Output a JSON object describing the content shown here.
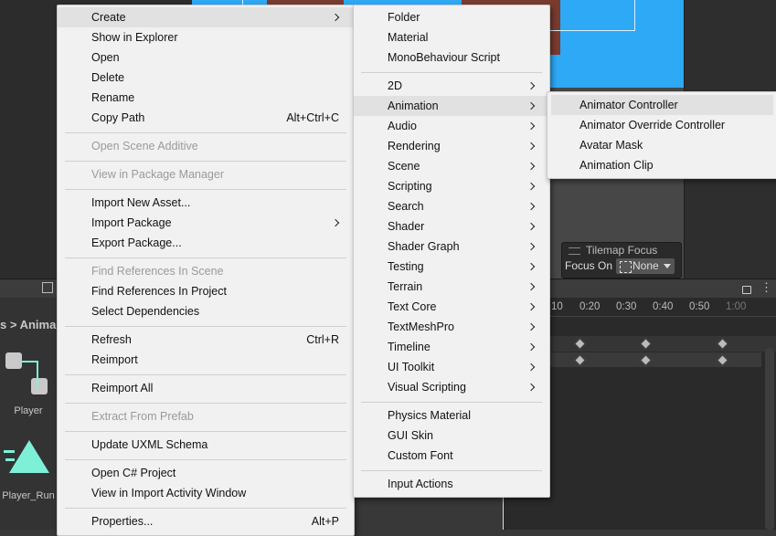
{
  "context_menu": {
    "items": [
      {
        "label": "Create",
        "submenu": true
      },
      {
        "label": "Show in Explorer"
      },
      {
        "label": "Open"
      },
      {
        "label": "Delete"
      },
      {
        "label": "Rename"
      },
      {
        "label": "Copy Path",
        "shortcut": "Alt+Ctrl+C"
      },
      {
        "label": "Open Scene Additive",
        "disabled": true
      },
      {
        "label": "View in Package Manager",
        "disabled": true
      },
      {
        "label": "Import New Asset..."
      },
      {
        "label": "Import Package",
        "submenu": true
      },
      {
        "label": "Export Package..."
      },
      {
        "label": "Find References In Scene",
        "disabled": true
      },
      {
        "label": "Find References In Project"
      },
      {
        "label": "Select Dependencies"
      },
      {
        "label": "Refresh",
        "shortcut": "Ctrl+R"
      },
      {
        "label": "Reimport"
      },
      {
        "label": "Reimport All"
      },
      {
        "label": "Extract From Prefab",
        "disabled": true
      },
      {
        "label": "Update UXML Schema"
      },
      {
        "label": "Open C# Project"
      },
      {
        "label": "View in Import Activity Window"
      },
      {
        "label": "Properties...",
        "shortcut": "Alt+P"
      }
    ]
  },
  "create_menu": {
    "items": [
      {
        "label": "Folder"
      },
      {
        "label": "Material"
      },
      {
        "label": "MonoBehaviour Script"
      },
      {
        "label": "2D",
        "submenu": true
      },
      {
        "label": "Animation",
        "submenu": true
      },
      {
        "label": "Audio",
        "submenu": true
      },
      {
        "label": "Rendering",
        "submenu": true
      },
      {
        "label": "Scene",
        "submenu": true
      },
      {
        "label": "Scripting",
        "submenu": true
      },
      {
        "label": "Search",
        "submenu": true
      },
      {
        "label": "Shader",
        "submenu": true
      },
      {
        "label": "Shader Graph",
        "submenu": true
      },
      {
        "label": "Testing",
        "submenu": true
      },
      {
        "label": "Terrain",
        "submenu": true
      },
      {
        "label": "Text Core",
        "submenu": true
      },
      {
        "label": "TextMeshPro",
        "submenu": true
      },
      {
        "label": "Timeline",
        "submenu": true
      },
      {
        "label": "UI Toolkit",
        "submenu": true
      },
      {
        "label": "Visual Scripting",
        "submenu": true
      },
      {
        "label": "Physics Material"
      },
      {
        "label": "GUI Skin"
      },
      {
        "label": "Custom Font"
      },
      {
        "label": "Input Actions"
      }
    ]
  },
  "animation_menu": {
    "items": [
      {
        "label": "Animator Controller"
      },
      {
        "label": "Animator Override Controller"
      },
      {
        "label": "Avatar Mask"
      },
      {
        "label": "Animation Clip"
      }
    ]
  },
  "tilemap_focus": {
    "title": "Tilemap Focus",
    "focus_label": "Focus On",
    "value": "None"
  },
  "project": {
    "breadcrumb": "s > Anima",
    "assets": [
      "Player",
      "Player_Run"
    ]
  },
  "timeline_ruler": [
    "10",
    "0:20",
    "0:30",
    "0:40",
    "0:50",
    "1:00"
  ],
  "colors": {
    "scene_blue": "#2ea9f5",
    "menu_bg": "#f1f1f1",
    "highlight": "#e1e1e1",
    "asset_cyan": "#7ff0d8"
  }
}
